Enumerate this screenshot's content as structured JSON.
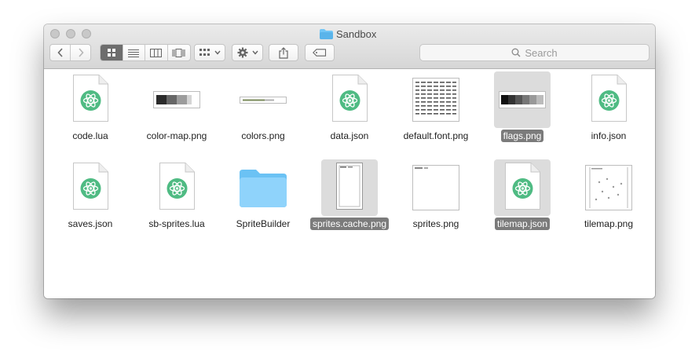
{
  "window": {
    "title": "Sandbox"
  },
  "search": {
    "placeholder": "Search"
  },
  "files": [
    {
      "name": "code.lua",
      "icon": "atom-doc-icon",
      "selected": false
    },
    {
      "name": "color-map.png",
      "icon": "image-thumb-icon",
      "selected": false
    },
    {
      "name": "colors.png",
      "icon": "image-thumb-icon",
      "selected": false
    },
    {
      "name": "data.json",
      "icon": "atom-doc-icon",
      "selected": false
    },
    {
      "name": "default.font.png",
      "icon": "image-thumb-icon",
      "selected": false
    },
    {
      "name": "flags.png",
      "icon": "image-thumb-icon",
      "selected": true
    },
    {
      "name": "info.json",
      "icon": "atom-doc-icon",
      "selected": false
    },
    {
      "name": "saves.json",
      "icon": "atom-doc-icon",
      "selected": false
    },
    {
      "name": "sb-sprites.lua",
      "icon": "atom-doc-icon",
      "selected": false
    },
    {
      "name": "SpriteBuilder",
      "icon": "folder-icon",
      "selected": false
    },
    {
      "name": "sprites.cache.png",
      "icon": "image-thumb-icon",
      "selected": true
    },
    {
      "name": "sprites.png",
      "icon": "image-thumb-icon",
      "selected": false
    },
    {
      "name": "tilemap.json",
      "icon": "atom-doc-icon",
      "selected": true
    },
    {
      "name": "tilemap.png",
      "icon": "image-thumb-icon",
      "selected": false
    }
  ],
  "colors": {
    "accent_selected": "#7b7b7b",
    "folder": "#6cc4f7",
    "atom": "#4fbb83"
  }
}
